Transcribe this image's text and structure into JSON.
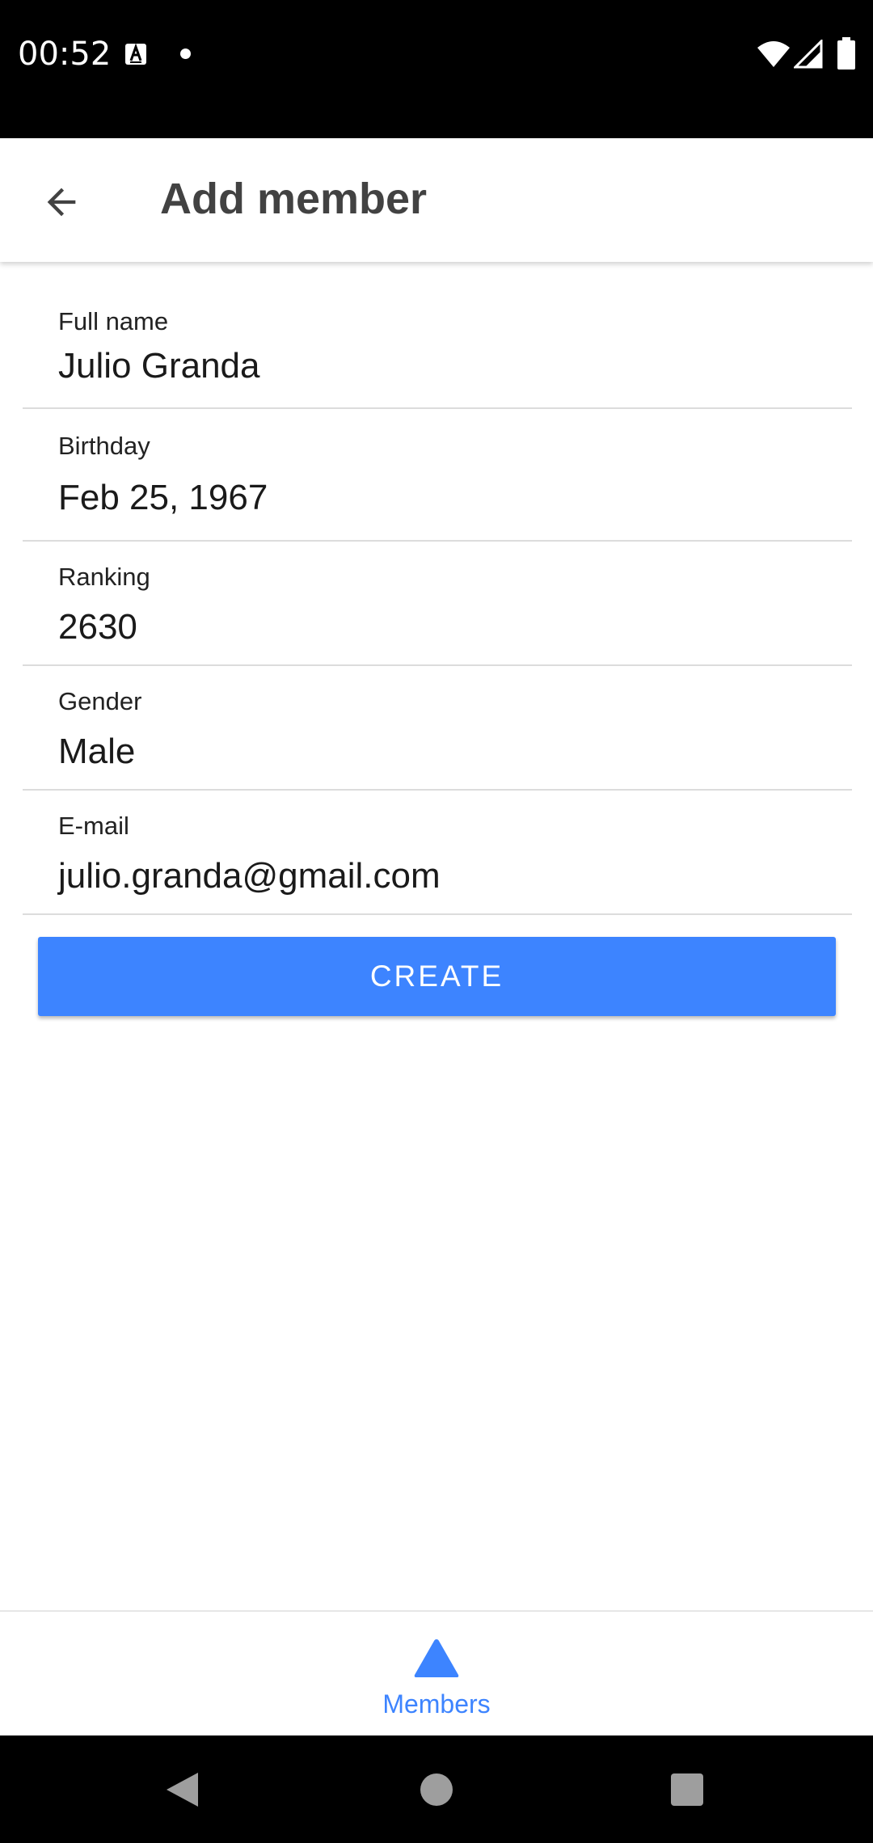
{
  "status_bar": {
    "time": "00:52",
    "icons": [
      "text-a-icon",
      "notification-dot-icon",
      "wifi-icon",
      "signal-icon",
      "battery-icon"
    ]
  },
  "app_bar": {
    "title": "Add member",
    "back_icon": "arrow-back-icon"
  },
  "form": {
    "fields": [
      {
        "label": "Full name",
        "value": "Julio Granda"
      },
      {
        "label": "Birthday",
        "value": "Feb 25, 1967"
      },
      {
        "label": "Ranking",
        "value": "2630"
      },
      {
        "label": "Gender",
        "value": "Male"
      },
      {
        "label": "E-mail",
        "value": "julio.granda@gmail.com"
      }
    ],
    "submit_label": "CREATE"
  },
  "bottom_nav": {
    "items": [
      {
        "label": "Members",
        "icon": "triangle-icon",
        "active": true
      }
    ]
  },
  "colors": {
    "accent": "#3d84ff",
    "title_text": "#424242",
    "divider": "#dcdcdc"
  }
}
